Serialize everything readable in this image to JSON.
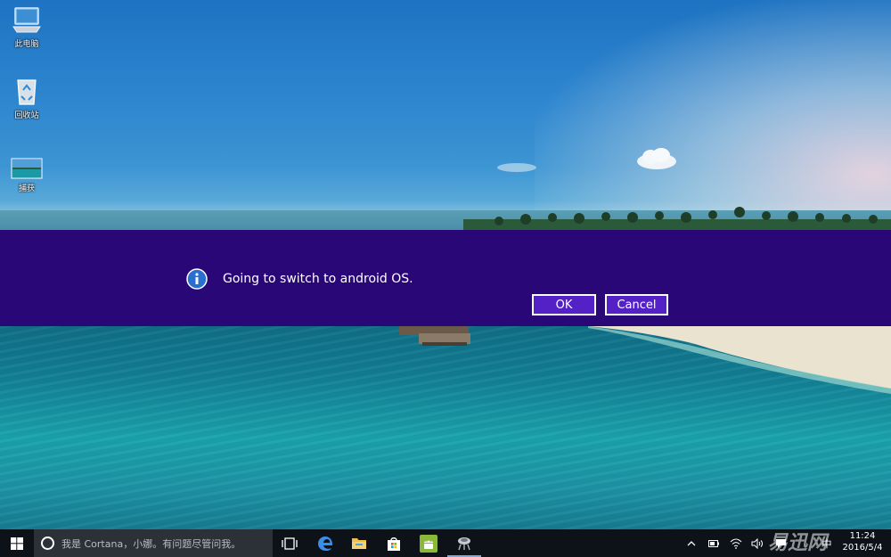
{
  "desktop": {
    "icons": [
      {
        "label": "此电脑",
        "icon": "computer-icon"
      },
      {
        "label": "回收站",
        "icon": "recycle-bin-icon"
      },
      {
        "label": "捕获",
        "icon": "image-file-icon"
      }
    ]
  },
  "dialog": {
    "icon": "info-icon",
    "message": "Going to switch to android OS.",
    "ok_label": "OK",
    "cancel_label": "Cancel",
    "background_color": "#2a0777",
    "button_color": "#5421c6"
  },
  "taskbar": {
    "start_icon": "windows-logo-icon",
    "search_placeholder": "我是 Cortana，小娜。有问题尽管问我。",
    "apps": [
      {
        "name": "task-view",
        "icon": "task-view-icon"
      },
      {
        "name": "edge",
        "icon": "edge-icon"
      },
      {
        "name": "file-explorer",
        "icon": "folder-icon"
      },
      {
        "name": "store",
        "icon": "store-icon"
      },
      {
        "name": "android",
        "icon": "android-icon"
      },
      {
        "name": "app",
        "icon": "app-icon"
      }
    ],
    "tray": {
      "ime": "中",
      "icons": [
        "chevron-up-icon",
        "battery-icon",
        "wifi-icon",
        "speaker-icon",
        "notification-icon"
      ]
    },
    "clock": {
      "time": "11:24",
      "date": "2016/5/4"
    },
    "watermark": "易迅网"
  }
}
